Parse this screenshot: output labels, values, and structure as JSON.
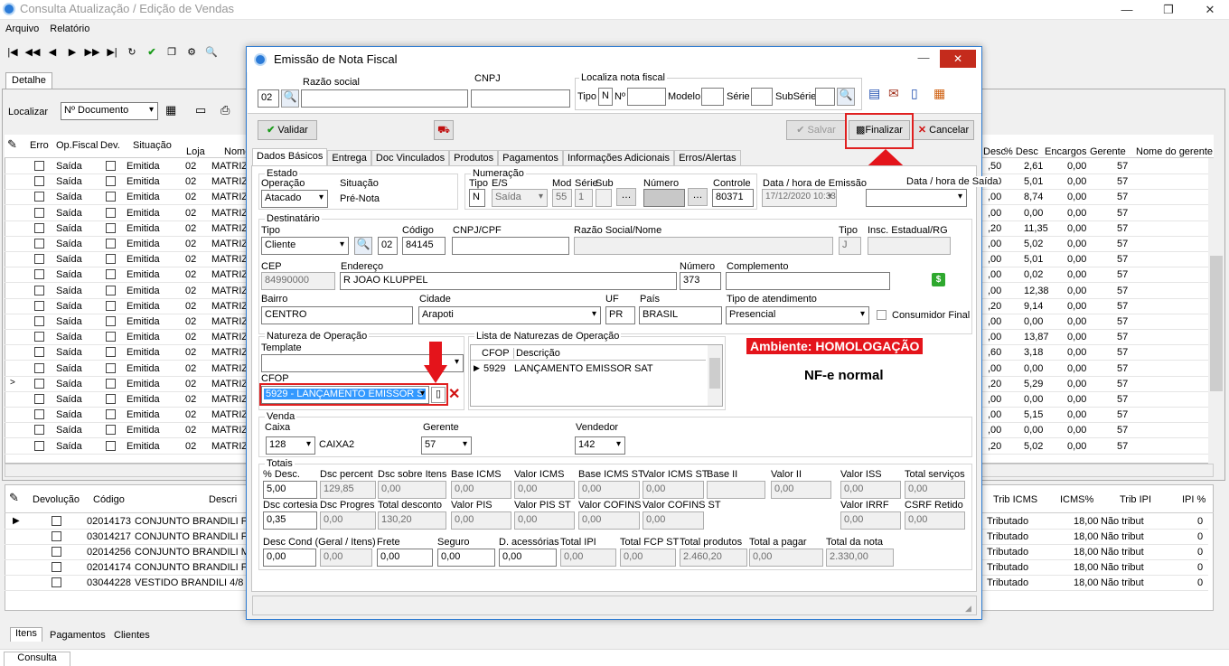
{
  "main_window": {
    "title": "Consulta Atualização / Edição de Vendas",
    "menu": [
      "Arquivo",
      "Relatório"
    ],
    "tab": "Detalhe",
    "localizar_label": "Localizar",
    "localizar_value": "Nº Documento",
    "columns": [
      "Erro",
      "Op.Fiscal",
      "Dev.",
      "Situação",
      "Loja",
      "Nome"
    ],
    "right_columns": [
      "Desc",
      "% Desc",
      "Encargos",
      "Gerente",
      "Nome do gerente"
    ],
    "rows": [
      {
        "op": "Saída",
        "sit": "Emitida",
        "loja": "02",
        "nome": "MATRIZ",
        "desc": ",50",
        "pdesc": "2,61",
        "enc": "0,00",
        "ger": "57"
      },
      {
        "op": "Saída",
        "sit": "Emitida",
        "loja": "02",
        "nome": "MATRIZ",
        "desc": ",00",
        "pdesc": "5,01",
        "enc": "0,00",
        "ger": "57"
      },
      {
        "op": "Saída",
        "sit": "Emitida",
        "loja": "02",
        "nome": "MATRIZ",
        "desc": ",00",
        "pdesc": "8,74",
        "enc": "0,00",
        "ger": "57"
      },
      {
        "op": "Saída",
        "sit": "Emitida",
        "loja": "02",
        "nome": "MATRIZ",
        "desc": ",00",
        "pdesc": "0,00",
        "enc": "0,00",
        "ger": "57"
      },
      {
        "op": "Saída",
        "sit": "Emitida",
        "loja": "02",
        "nome": "MATRIZ",
        "desc": ",20",
        "pdesc": "11,35",
        "enc": "0,00",
        "ger": "57"
      },
      {
        "op": "Saída",
        "sit": "Emitida",
        "loja": "02",
        "nome": "MATRIZ",
        "desc": ",00",
        "pdesc": "5,02",
        "enc": "0,00",
        "ger": "57"
      },
      {
        "op": "Saída",
        "sit": "Emitida",
        "loja": "02",
        "nome": "MATRIZ",
        "desc": ",00",
        "pdesc": "5,01",
        "enc": "0,00",
        "ger": "57"
      },
      {
        "op": "Saída",
        "sit": "Emitida",
        "loja": "02",
        "nome": "MATRIZ",
        "desc": ",00",
        "pdesc": "0,02",
        "enc": "0,00",
        "ger": "57"
      },
      {
        "op": "Saída",
        "sit": "Emitida",
        "loja": "02",
        "nome": "MATRIZ",
        "desc": ",00",
        "pdesc": "12,38",
        "enc": "0,00",
        "ger": "57"
      },
      {
        "op": "Saída",
        "sit": "Emitida",
        "loja": "02",
        "nome": "MATRIZ",
        "desc": ",20",
        "pdesc": "9,14",
        "enc": "0,00",
        "ger": "57"
      },
      {
        "op": "Saída",
        "sit": "Emitida",
        "loja": "02",
        "nome": "MATRIZ",
        "desc": ",00",
        "pdesc": "0,00",
        "enc": "0,00",
        "ger": "57"
      },
      {
        "op": "Saída",
        "sit": "Emitida",
        "loja": "02",
        "nome": "MATRIZ",
        "desc": ",00",
        "pdesc": "13,87",
        "enc": "0,00",
        "ger": "57"
      },
      {
        "op": "Saída",
        "sit": "Emitida",
        "loja": "02",
        "nome": "MATRIZ",
        "desc": ",60",
        "pdesc": "3,18",
        "enc": "0,00",
        "ger": "57"
      },
      {
        "op": "Saída",
        "sit": "Emitida",
        "loja": "02",
        "nome": "MATRIZ",
        "desc": ",00",
        "pdesc": "0,00",
        "enc": "0,00",
        "ger": "57"
      },
      {
        "op": "Saída",
        "sit": "Emitida",
        "loja": "02",
        "nome": "MATRIZ",
        "desc": ",20",
        "pdesc": "5,29",
        "enc": "0,00",
        "ger": "57"
      },
      {
        "op": "Saída",
        "sit": "Emitida",
        "loja": "02",
        "nome": "MATRIZ",
        "desc": ",00",
        "pdesc": "0,00",
        "enc": "0,00",
        "ger": "57"
      },
      {
        "op": "Saída",
        "sit": "Emitida",
        "loja": "02",
        "nome": "MATRIZ",
        "desc": ",00",
        "pdesc": "5,15",
        "enc": "0,00",
        "ger": "57"
      },
      {
        "op": "Saída",
        "sit": "Emitida",
        "loja": "02",
        "nome": "MATRIZ",
        "desc": ",00",
        "pdesc": "0,00",
        "enc": "0,00",
        "ger": "57"
      },
      {
        "op": "Saída",
        "sit": "Emitida",
        "loja": "02",
        "nome": "MATRIZ",
        "desc": ",20",
        "pdesc": "5,02",
        "enc": "0,00",
        "ger": "57"
      }
    ],
    "item_columns": [
      "Devolução",
      "Código",
      "Descri"
    ],
    "item_right_columns": [
      "Trib ICMS",
      "ICMS%",
      "Trib IPI",
      "IPI %"
    ],
    "items": [
      {
        "cod": "02014173",
        "desc": "CONJUNTO BRANDILI FE",
        "trib": "Tributado",
        "icms": "18,00",
        "ipi": "Não tribut",
        "ipip": "0"
      },
      {
        "cod": "03014217",
        "desc": "CONJUNTO BRANDILI FE",
        "trib": "Tributado",
        "icms": "18,00",
        "ipi": "Não tribut",
        "ipip": "0"
      },
      {
        "cod": "02014256",
        "desc": "CONJUNTO BRANDILI MA",
        "trib": "Tributado",
        "icms": "18,00",
        "ipi": "Não tribut",
        "ipip": "0"
      },
      {
        "cod": "02014174",
        "desc": "CONJUNTO BRANDILI FE",
        "trib": "Tributado",
        "icms": "18,00",
        "ipi": "Não tribut",
        "ipip": "0"
      },
      {
        "cod": "03044228",
        "desc": "VESTIDO BRANDILI 4/8 3",
        "trib": "Tributado",
        "icms": "18,00",
        "ipi": "Não tribut",
        "ipip": "0"
      }
    ],
    "bottom_tabs": [
      "Itens",
      "Pagamentos",
      "Clientes"
    ],
    "status_tab": "Consulta"
  },
  "dialog": {
    "title": "Emissão de Nota Fiscal",
    "loja": "02",
    "razao_label": "Razão social",
    "cnpj_label": "CNPJ",
    "localiza_label": "Localiza nota fiscal",
    "tipo_label": "Tipo",
    "tipo_value": "N",
    "n_label": "Nº",
    "modelo_label": "Modelo",
    "serie_label": "Série",
    "subserie_label": "SubSérie",
    "validar": "Validar",
    "salvar": "Salvar",
    "finalizar": "Finalizar",
    "cancelar": "Cancelar",
    "tabs": [
      "Dados Básicos",
      "Entrega",
      "Doc Vinculados",
      "Produtos",
      "Pagamentos",
      "Informações Adicionais",
      "Erros/Alertas"
    ],
    "estado_label": "Estado",
    "operacao_label": "Operação",
    "operacao_value": "Atacado",
    "situacao_label": "Situação",
    "situacao_value": "Pré-Nota",
    "numeracao_label": "Numeração",
    "num_tipo_label": "Tipo",
    "num_tipo": "N",
    "es_label": "E/S",
    "es_value": "Saída",
    "mod_label": "Mod",
    "mod_value": "55",
    "serie_value": "1",
    "sub_label": "Sub",
    "numero_label": "Número",
    "controle_label": "Controle",
    "controle_value": "80371",
    "data_emissao_label": "Data / hora de Emissão",
    "data_emissao": "17/12/2020 10:33",
    "data_saida_label": "Data / hora de Saída",
    "dest_label": "Destinatário",
    "dest_tipo_label": "Tipo",
    "dest_tipo": "Cliente",
    "codigo_label": "Código",
    "codigo_loja": "02",
    "codigo": "84145",
    "cnpjcpf_label": "CNPJ/CPF",
    "razaonome_label": "Razão Social/Nome",
    "tipo2_label": "Tipo",
    "tipo2_value": "J",
    "ie_label": "Insc. Estadual/RG",
    "cep_label": "CEP",
    "cep": "84990000",
    "end_label": "Endereço",
    "endereco": "R JOAO KLUPPEL",
    "numero2_label": "Número",
    "numero2": "373",
    "compl_label": "Complemento",
    "bairro_label": "Bairro",
    "bairro": "CENTRO",
    "cidade_label": "Cidade",
    "cidade": "Arapoti",
    "uf_label": "UF",
    "uf": "PR",
    "pais_label": "País",
    "pais": "BRASIL",
    "atend_label": "Tipo de atendimento",
    "atend": "Presencial",
    "consumidor_label": "Consumidor Final",
    "natureza_label": "Natureza de Operação",
    "template_label": "Template",
    "cfop_label": "CFOP",
    "cfop_value": "5929  - LANÇAMENTO EMISSOR S",
    "lista_label": "Lista de Naturezas de Operação",
    "lista_cols": [
      "CFOP",
      "Descrição"
    ],
    "lista_cfop": "5929",
    "lista_desc": "LANÇAMENTO EMISSOR SAT",
    "ambiente": "Ambiente: HOMOLOGAÇÃO",
    "nfe": "NF-e normal",
    "venda_label": "Venda",
    "caixa_label": "Caixa",
    "caixa": "128",
    "caixa_name": "CAIXA2",
    "gerente_label": "Gerente",
    "gerente": "57",
    "vendedor_label": "Vendedor",
    "vendedor": "142",
    "totais_label": "Totais",
    "t_pdesc_l": "% Desc.",
    "t_pdesc": "5,00",
    "t_dscperc_l": "Dsc percent",
    "t_dscperc": "129,85",
    "t_dscitens_l": "Dsc sobre Itens",
    "t_dscitens": "0,00",
    "t_bicms_l": "Base ICMS",
    "t_bicms": "0,00",
    "t_vicms_l": "Valor ICMS",
    "t_vicms": "0,00",
    "t_bicmsst_l": "Base ICMS ST",
    "t_bicmsst": "0,00",
    "t_vicmsst_l": "Valor ICMS ST",
    "t_vicmsst": "0,00",
    "t_bii_l": "Base II",
    "t_vii_l": "Valor II",
    "t_vii": "0,00",
    "t_viss_l": "Valor ISS",
    "t_viss": "0,00",
    "t_tserv_l": "Total serviços",
    "t_tserv": "0,00",
    "t_cort_l": "Dsc cortesia",
    "t_cort": "0,35",
    "t_prog_l": "Dsc Progres",
    "t_prog": "0,00",
    "t_tdesc_l": "Total desconto",
    "t_tdesc": "130,20",
    "t_vpis_l": "Valor PIS",
    "t_vpis": "0,00",
    "t_vpisst_l": "Valor PIS ST",
    "t_vpisst": "0,00",
    "t_vcof_l": "Valor COFINS",
    "t_vcof": "0,00",
    "t_vcofst_l": "Valor COFINS ST",
    "t_vcofst": "0,00",
    "t_virrf_l": "Valor IRRF",
    "t_virrf": "0,00",
    "t_csrf_l": "CSRF Retido",
    "t_csrf": "0,00",
    "t_dcond_l": "Desc Cond (Geral / Itens)",
    "t_dcond1": "0,00",
    "t_dcond2": "0,00",
    "t_frete_l": "Frete",
    "t_frete": "0,00",
    "t_seg_l": "Seguro",
    "t_seg": "0,00",
    "t_dacc_l": "D. acessórias",
    "t_dacc": "0,00",
    "t_tipi_l": "Total IPI",
    "t_tipi": "0,00",
    "t_fcp_l": "Total FCP ST",
    "t_fcp": "0,00",
    "t_tprod_l": "Total produtos",
    "t_tprod": "2.460,20",
    "t_tpagar_l": "Total a pagar",
    "t_tpagar": "0,00",
    "t_tnota_l": "Total da nota",
    "t_tnota": "2.330,00"
  },
  "colors": {
    "accent": "#2d7bd1",
    "highlight_red": "#e02020",
    "ambiente_bg": "#e4141b",
    "selection": "#3399ff"
  }
}
